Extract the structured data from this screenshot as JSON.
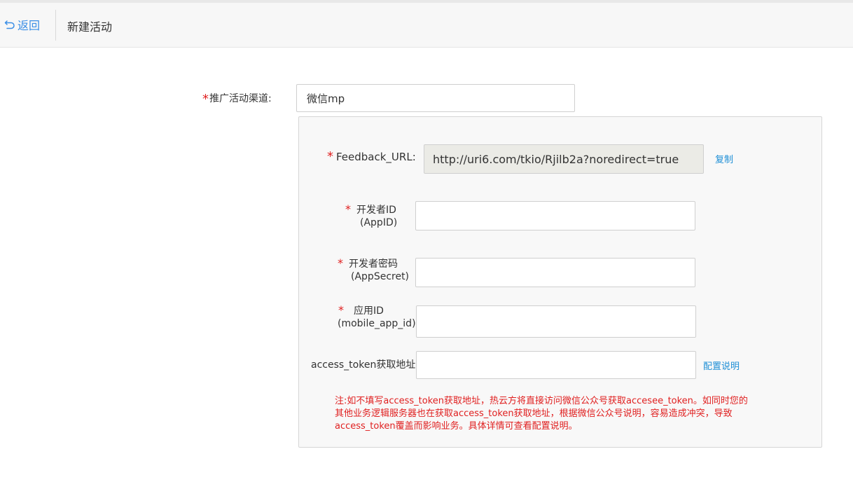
{
  "header": {
    "back_label": "返回",
    "title": "新建活动"
  },
  "form": {
    "required_mark": "*",
    "channel": {
      "label": "推广活动渠道:",
      "value": "微信mp"
    },
    "feedback_url": {
      "label": "Feedback_URL:",
      "value": "http://uri6.com/tkio/Rjilb2a?noredirect=true",
      "copy_label": "复制"
    },
    "app_id": {
      "label_line1": "开发者ID",
      "label_line2": "(AppID)",
      "value": ""
    },
    "app_secret": {
      "label_line1": "开发者密码",
      "label_line2": "(AppSecret)",
      "value": ""
    },
    "mobile_app_id": {
      "label_line1": "应用ID",
      "label_line2": "(mobile_app_id)",
      "value": ""
    },
    "access_token": {
      "label": "access_token获取地址",
      "value": "",
      "help_link": "配置说明"
    },
    "note_lines": [
      "注:如不填写access_token获取地址，热云方将直接访问微信公众号获取accesee_token。如同时您的",
      "其他业务逻辑服务器也在获取access_token获取地址，根据微信公众号说明，容易造成冲突，导致",
      "access_token覆盖而影响业务。具体详情可查看配置说明。"
    ]
  },
  "colors": {
    "accent_link": "#1e8fd6",
    "required": "#e02020",
    "back": "#3a8ee6"
  }
}
